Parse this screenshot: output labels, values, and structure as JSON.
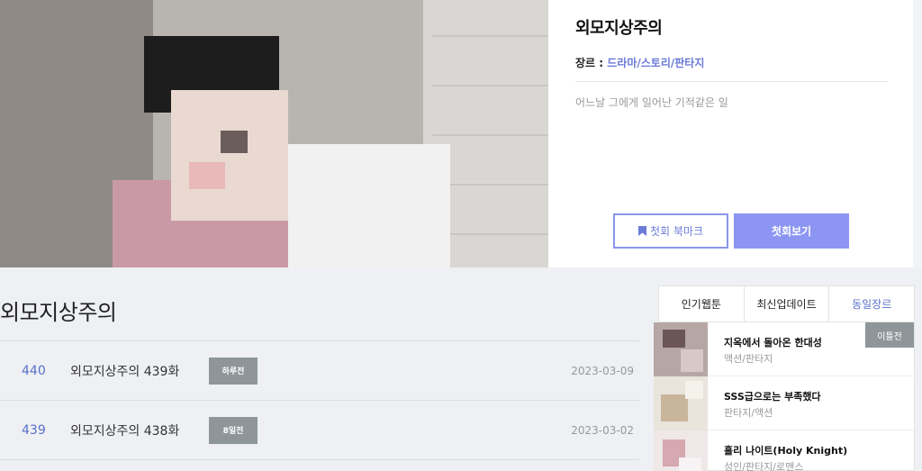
{
  "webtoon": {
    "title": "외모지상주의",
    "genre_label": "장르 : ",
    "genre_value": "드라마/스토리/판타지",
    "description": "어느날 그에게 일어난 기적같은 일",
    "bookmark_label": "첫회 북마크",
    "first_episode_label": "첫회보기"
  },
  "episodes": {
    "section_title": "외모지상주의",
    "items": [
      {
        "number": "440",
        "name": "외모지상주의 439화",
        "badge": "하루전",
        "date": "2023-03-09"
      },
      {
        "number": "439",
        "name": "외모지상주의 438화",
        "badge": "8일전",
        "date": "2023-03-02"
      }
    ]
  },
  "sidebar": {
    "tabs": [
      "인기웹툰",
      "최신업데이트",
      "동일장르"
    ],
    "items": [
      {
        "title": "지옥에서 돌아온 한대성",
        "genre": "액션/판타지",
        "badge": "이틀전"
      },
      {
        "title": "SSS급으로는 부족했다",
        "genre": "판타지/액션",
        "badge": ""
      },
      {
        "title": "홀리 나이트(Holy Knight)",
        "genre": "성인/판타지/로맨스",
        "badge": ""
      }
    ]
  },
  "colors": {
    "accent": "#8c96f2",
    "link": "#5a6fc9",
    "badge": "#8e9699"
  }
}
